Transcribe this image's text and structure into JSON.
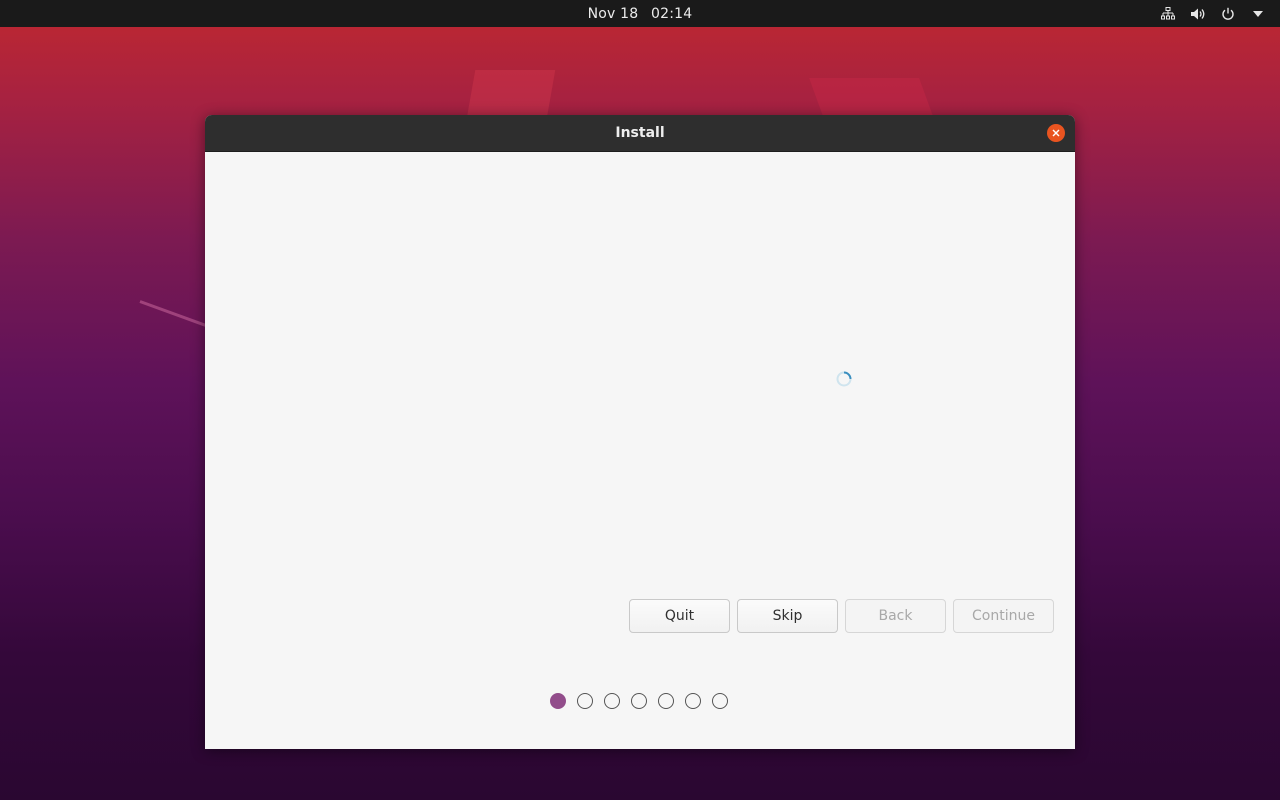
{
  "top_panel": {
    "date": "Nov 18",
    "time": "02:14",
    "tray_icons": [
      "network-icon",
      "volume-icon",
      "power-icon",
      "menu-arrow-icon"
    ]
  },
  "window": {
    "title": "Install",
    "loading_indicator": "spinner-icon",
    "buttons": {
      "quit": "Quit",
      "skip": "Skip",
      "back": "Back",
      "continue": "Continue"
    },
    "progress": {
      "total_steps": 7,
      "current_step": 1
    }
  },
  "colors": {
    "accent": "#e95420",
    "progress_active": "#924d8b",
    "panel": "#1a1a1a",
    "titlebar": "#2e2e2e"
  }
}
